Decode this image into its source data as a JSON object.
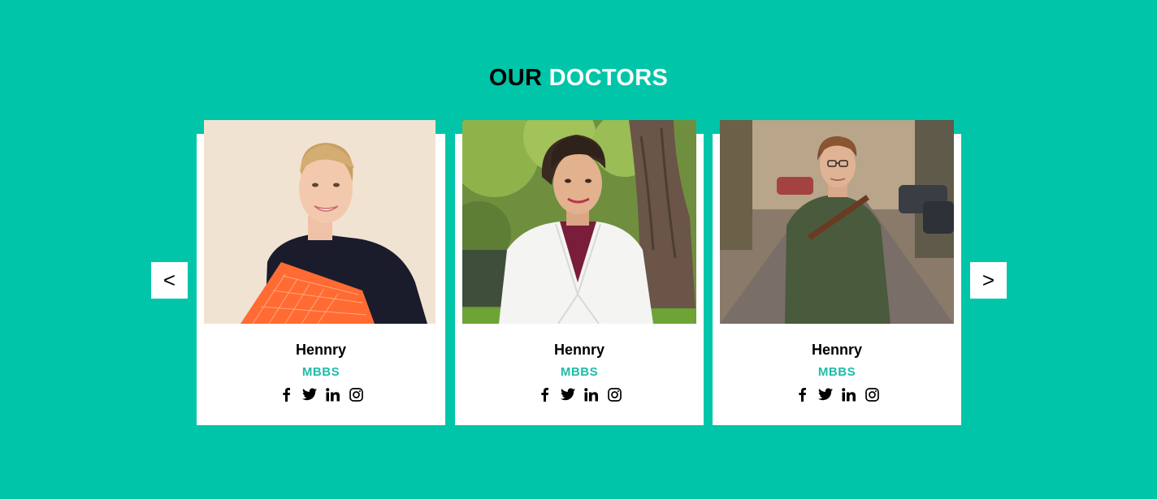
{
  "heading": {
    "word1": "OUR",
    "word2": "DOCTORS"
  },
  "nav": {
    "prev_label": "<",
    "next_label": ">"
  },
  "doctors": [
    {
      "name": "Hennry",
      "degree": "MBBS"
    },
    {
      "name": "Hennry",
      "degree": "MBBS"
    },
    {
      "name": "Hennry",
      "degree": "MBBS"
    }
  ],
  "social_icons": [
    "facebook-icon",
    "twitter-icon",
    "linkedin-icon",
    "instagram-icon"
  ],
  "colors": {
    "background": "#00c5a9",
    "accent": "#1fbba9",
    "card": "#ffffff"
  }
}
